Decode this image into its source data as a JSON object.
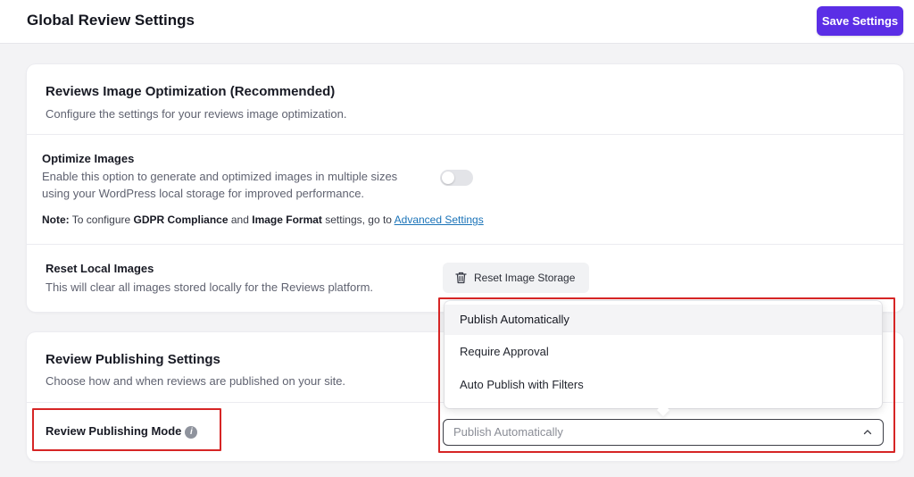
{
  "header": {
    "title": "Global Review Settings",
    "save_label": "Save Settings"
  },
  "image_optimization": {
    "title": "Reviews Image Optimization (Recommended)",
    "subtitle": "Configure the settings for your reviews image optimization.",
    "optimize": {
      "label": "Optimize Images",
      "desc_line1": "Enable this option to generate and optimized images in multiple sizes",
      "desc_line2": "using your WordPress local storage for improved performance.",
      "enabled": false
    },
    "note": {
      "prefix": "Note:",
      "text1": " To configure ",
      "bold1": "GDPR Compliance",
      "text2": " and ",
      "bold2": "Image Format",
      "text3": " settings, go to ",
      "link": "Advanced Settings"
    },
    "reset": {
      "label": "Reset Local Images",
      "desc": "This will clear all images stored locally for the Reviews platform.",
      "button_label": "Reset Image Storage"
    }
  },
  "publishing": {
    "title": "Review Publishing Settings",
    "subtitle": "Choose how and when reviews are published on your site.",
    "mode_label": "Review Publishing Mode",
    "selected_value": "Publish Automatically",
    "options": [
      "Publish Automatically",
      "Require Approval",
      "Auto Publish with Filters"
    ]
  },
  "colors": {
    "accent": "#5b2ee6",
    "highlight": "#d62525",
    "link": "#1a73b8"
  }
}
